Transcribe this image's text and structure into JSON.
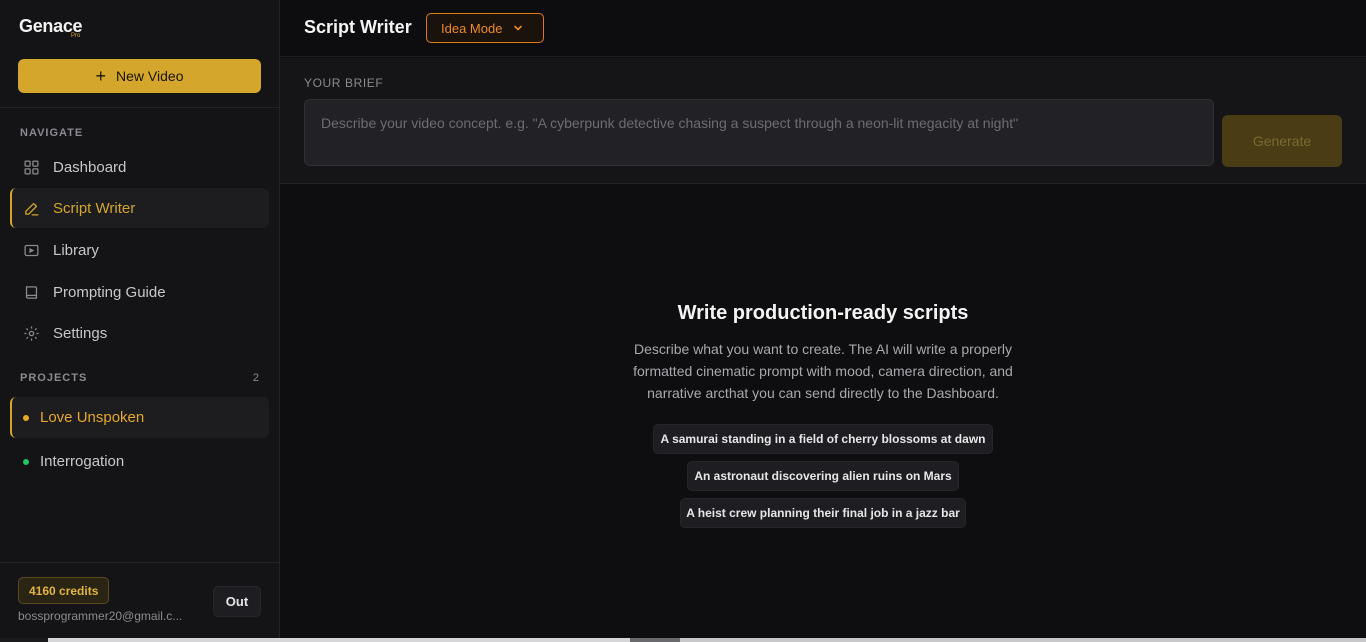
{
  "brand": {
    "name": "Genace",
    "tier": "Pro"
  },
  "sidebar": {
    "new_video_label": "New Video",
    "navigate_label": "NAVIGATE",
    "nav": [
      {
        "label": "Dashboard",
        "icon": "grid-icon"
      },
      {
        "label": "Script Writer",
        "icon": "pencil-icon",
        "active": true
      },
      {
        "label": "Library",
        "icon": "video-icon"
      },
      {
        "label": "Prompting Guide",
        "icon": "book-icon"
      },
      {
        "label": "Settings",
        "icon": "gear-icon"
      }
    ],
    "projects_label": "PROJECTS",
    "projects_count": "2",
    "projects": [
      {
        "label": "Love Unspoken",
        "dot_color": "#e6a82a",
        "active": true
      },
      {
        "label": "Interrogation",
        "dot_color": "#22c55e"
      }
    ],
    "credits": "4160 credits",
    "email": "bossprogrammer20@gmail.c...",
    "out_label": "Out"
  },
  "header": {
    "title": "Script Writer",
    "mode": "Idea Mode"
  },
  "brief": {
    "label": "YOUR BRIEF",
    "placeholder": "Describe your video concept. e.g. \"A cyberpunk detective chasing a suspect through a neon-lit megacity at night\"",
    "value": "",
    "generate_label": "Generate"
  },
  "empty_state": {
    "title": "Write production-ready scripts",
    "description": "Describe what you want to create. The AI will write a properly formatted cinematic prompt with mood, camera direction, and narrative arcthat you can send directly to the Dashboard.",
    "examples": [
      "A samurai standing in a field of cherry blossoms at dawn",
      "An astronaut discovering alien ruins on Mars",
      "A heist crew planning their final job in a jazz bar"
    ]
  },
  "colors": {
    "accent": "#d4a72c",
    "mode_accent": "#ef8a28",
    "background": "#0e0e10",
    "sidebar": "#141417"
  }
}
